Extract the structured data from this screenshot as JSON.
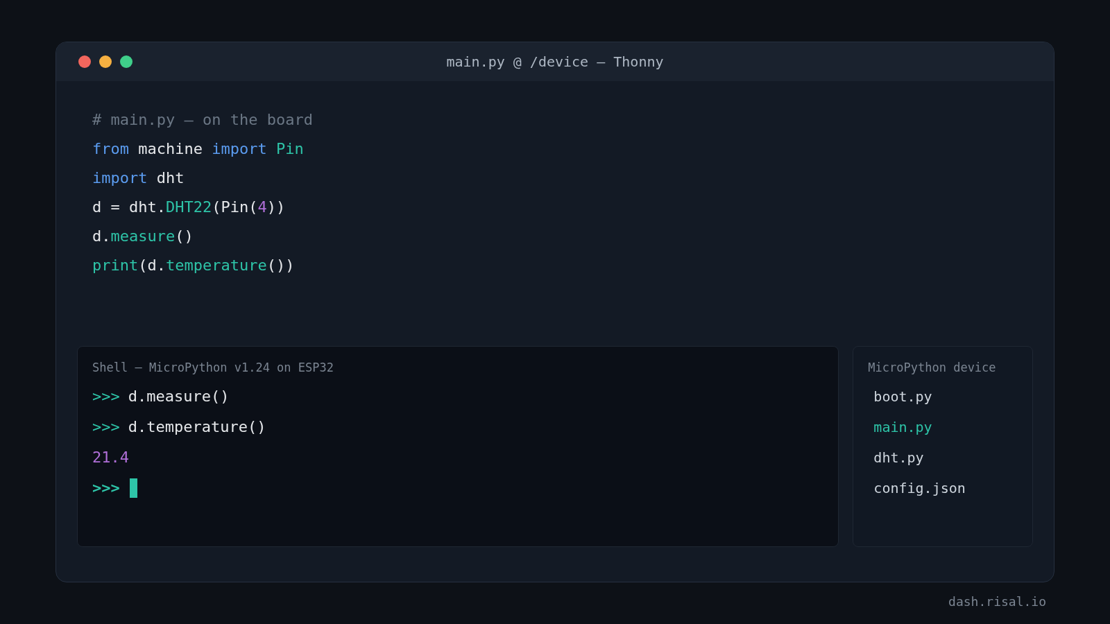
{
  "window": {
    "title": "main.py @ /device — Thonny"
  },
  "editor": {
    "lines": [
      [
        {
          "kind": "comment",
          "text": "# main.py — on the board"
        }
      ],
      [
        {
          "kind": "keyword",
          "text": "from"
        },
        {
          "kind": "plain",
          "text": " machine "
        },
        {
          "kind": "keyword",
          "text": "import"
        },
        {
          "kind": "name",
          "text": " Pin"
        }
      ],
      [
        {
          "kind": "keyword",
          "text": "import"
        },
        {
          "kind": "plain",
          "text": " dht"
        }
      ],
      [
        {
          "kind": "plain",
          "text": "d = dht."
        },
        {
          "kind": "name",
          "text": "DHT22"
        },
        {
          "kind": "plain",
          "text": "(Pin("
        },
        {
          "kind": "number",
          "text": "4"
        },
        {
          "kind": "plain",
          "text": "))"
        }
      ],
      [
        {
          "kind": "plain",
          "text": "d."
        },
        {
          "kind": "name",
          "text": "measure"
        },
        {
          "kind": "plain",
          "text": "()"
        }
      ],
      [
        {
          "kind": "name",
          "text": "print"
        },
        {
          "kind": "plain",
          "text": "(d."
        },
        {
          "kind": "name",
          "text": "temperature"
        },
        {
          "kind": "plain",
          "text": "())"
        }
      ]
    ]
  },
  "shell": {
    "title": "Shell — MicroPython v1.24 on ESP32",
    "lines": [
      {
        "kind": "input",
        "prompt": ">>>",
        "text": "d.measure()"
      },
      {
        "kind": "input",
        "prompt": ">>>",
        "text": "d.temperature()"
      },
      {
        "kind": "output",
        "text": "21.4"
      },
      {
        "kind": "cursor",
        "prompt": ">>>"
      }
    ]
  },
  "files": {
    "title": "MicroPython device",
    "items": [
      {
        "name": "boot.py",
        "selected": false
      },
      {
        "name": "main.py",
        "selected": true
      },
      {
        "name": "dht.py",
        "selected": false
      },
      {
        "name": "config.json",
        "selected": false
      }
    ]
  },
  "footer": "dash.risal.io"
}
